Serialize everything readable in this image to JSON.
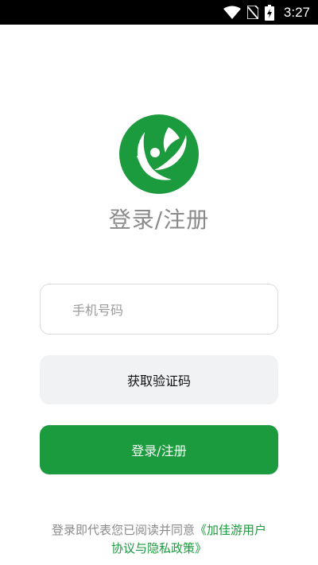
{
  "status_bar": {
    "time": "3:27",
    "icons": [
      "wifi-icon",
      "no-sim-icon",
      "battery-charging-icon"
    ]
  },
  "logo": {
    "name": "leaf-logo",
    "color": "#1b9a3e"
  },
  "title": "登录/注册",
  "phone_input": {
    "placeholder": "手机号码",
    "value": ""
  },
  "code_button": {
    "label": "获取验证码"
  },
  "login_button": {
    "label": "登录/注册"
  },
  "agreement": {
    "text": "登录即代表您已阅读并同意",
    "link": "《加佳游用户协议与隐私政策》"
  },
  "colors": {
    "accent": "#1b9a3e",
    "status_bar": "#000000",
    "secondary_button": "#f1f2f4",
    "muted_text": "#8a8a8a"
  }
}
